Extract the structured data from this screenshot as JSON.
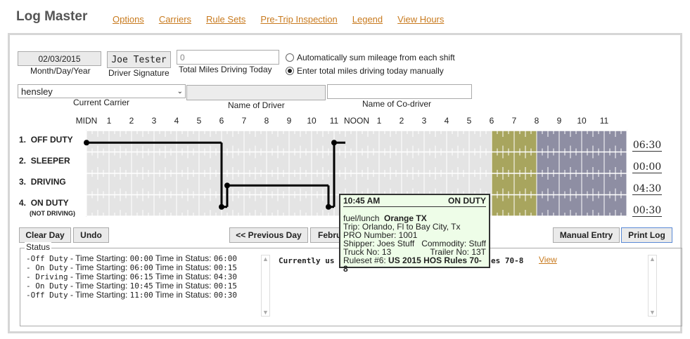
{
  "app": {
    "title": "Log Master"
  },
  "nav": [
    "Options",
    "Carriers",
    "Rule Sets",
    "Pre-Trip Inspection",
    "Legend",
    "View Hours"
  ],
  "form": {
    "date_value": "02/03/2015",
    "date_label": "Month/Day/Year",
    "signature_value": "Joe Tester",
    "signature_label": "Driver Signature",
    "miles_value": "0",
    "miles_label": "Total Miles Driving Today",
    "radio_auto_label": "Automatically sum mileage from each shift",
    "radio_manual_label": "Enter total miles driving today manually",
    "radio_selected": "manual",
    "carrier_value": "hensley",
    "carrier_label": "Current Carrier",
    "driver_name_label": "Name of Driver",
    "codriver_label": "Name of Co-driver"
  },
  "grid": {
    "hour_labels": [
      "MIDN",
      "1",
      "2",
      "3",
      "4",
      "5",
      "6",
      "7",
      "8",
      "9",
      "10",
      "11",
      "NOON",
      "1",
      "2",
      "3",
      "4",
      "5",
      "6",
      "7",
      "8",
      "9",
      "10",
      "11"
    ],
    "rows": [
      {
        "num": "1.",
        "label": "OFF DUTY",
        "sub": "",
        "total": "06:30"
      },
      {
        "num": "2.",
        "label": "SLEEPER",
        "sub": "",
        "total": "00:00"
      },
      {
        "num": "3.",
        "label": "DRIVING",
        "sub": "",
        "total": "04:30"
      },
      {
        "num": "4.",
        "label": "ON DUTY",
        "sub": "(NOT DRIVING)",
        "total": "00:30"
      }
    ],
    "duty_segments": [
      {
        "row": 0,
        "start": 0,
        "end": 6
      },
      {
        "row": 3,
        "start": 6,
        "end": 6.25
      },
      {
        "row": 2,
        "start": 6.25,
        "end": 10.75
      },
      {
        "row": 3,
        "start": 10.75,
        "end": 11
      },
      {
        "row": 0,
        "start": 11,
        "end": 11.5
      }
    ],
    "highlight_olive": [
      18,
      20
    ],
    "highlight_slate": [
      20,
      24
    ],
    "colors": {
      "olive": "#a8a55e",
      "slate": "#8e8ea3",
      "grid": "#e4e4e4"
    }
  },
  "buttons": {
    "clear_day": "Clear Day",
    "undo": "Undo",
    "previous_day": "<< Previous Day",
    "next_day_partial": "Febru",
    "manual_entry": "Manual Entry",
    "print_log": "Print Log"
  },
  "status": {
    "legend": "Status",
    "lines": [
      {
        "state": "-Off Duty",
        "start": "00:00",
        "in_status": "06:00"
      },
      {
        "state": "- On Duty",
        "start": "06:00",
        "in_status": "00:15"
      },
      {
        "state": "- Driving",
        "start": "06:15",
        "in_status": "04:30"
      },
      {
        "state": "- On Duty",
        "start": "10:45",
        "in_status": "00:15"
      },
      {
        "state": "-Off Duty",
        "start": "11:00",
        "in_status": "00:30"
      }
    ],
    "starting_label": "Time Starting:",
    "in_status_label": "Time in Status:",
    "ruleset_prefix": "Currently us",
    "ruleset_suffix": "es 70-8",
    "view_link": "View"
  },
  "tooltip": {
    "time": "10:45 AM",
    "status": "ON DUTY",
    "reason": "fuel/lunch",
    "location": "Orange TX",
    "trip": "Trip: Orlando, Fl to Bay City, Tx",
    "pro": "PRO Number: 1001",
    "shipper": "Shipper: Joes Stuff",
    "commodity": "Commodity: Stuff",
    "truck": "Truck No: 13",
    "trailer": "Trailer No: 13T",
    "ruleset_label": "Ruleset #6:",
    "ruleset_value": "US 2015 HOS Rules 70-8"
  }
}
